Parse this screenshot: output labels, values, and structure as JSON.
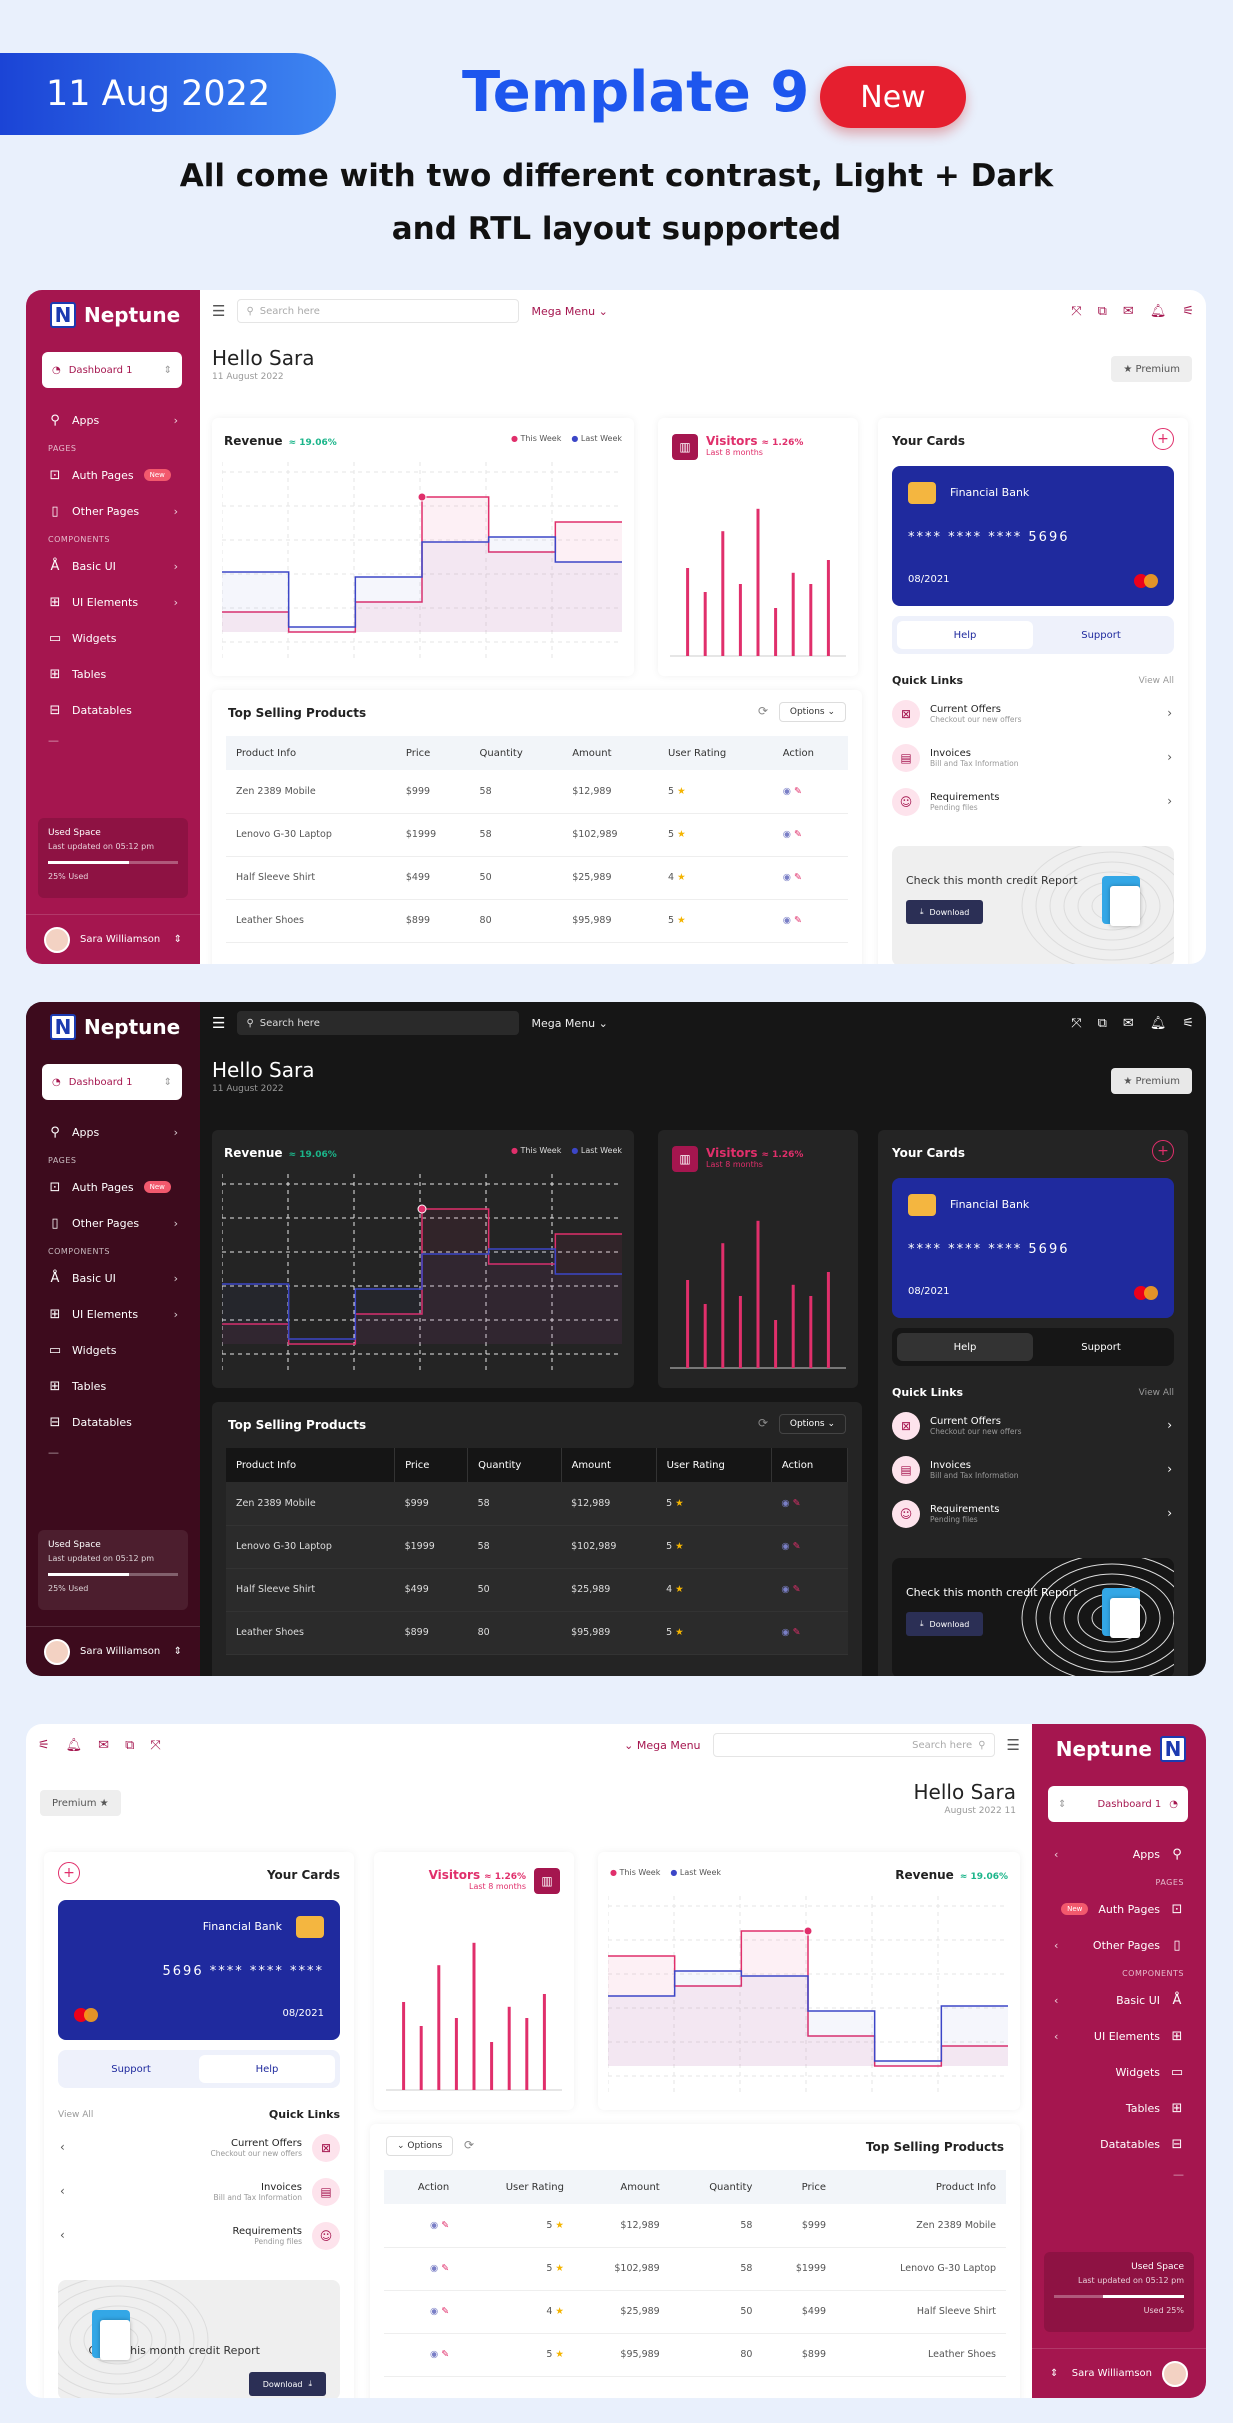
{
  "header": {
    "date": "11 Aug 2022",
    "title": "Template 9",
    "badge": "New",
    "subtitle_line1": "All come with two different contrast, Light + Dark",
    "subtitle_line2": "and RTL layout supported"
  },
  "app": {
    "brand": "Neptune",
    "logo_letter": "N",
    "dashboard_select": "Dashboard 1",
    "search_placeholder": "Search here",
    "mega_menu": "Mega Menu",
    "greeting": "Hello Sara",
    "date": "11 August 2022",
    "date_rtl": "August 2022 11",
    "premium": "★ Premium",
    "premium_rtl": "Premium ★",
    "nav": {
      "apps": "Apps",
      "pages_section": "PAGES",
      "auth_pages": "Auth Pages",
      "new_badge": "New",
      "other_pages": "Other Pages",
      "components_section": "COMPONENTS",
      "basic_ui": "Basic UI",
      "ui_elements": "UI Elements",
      "widgets": "Widgets",
      "tables": "Tables",
      "datatables": "Datatables",
      "dash": "—"
    },
    "space": {
      "title": "Used Space",
      "updated": "Last updated on 05:12 pm",
      "used": "25% Used",
      "used_rtl": "Used 25%",
      "percent": 0.25
    },
    "user": "Sara Williamson",
    "revenue": {
      "title": "Revenue",
      "pct": "≈ 19.06%",
      "legend_this": "This Week",
      "legend_last": "Last Week"
    },
    "visitors": {
      "title": "Visitors",
      "pct": "≈ 1.26%",
      "sub": "Last 8 months"
    },
    "cards": {
      "title": "Your Cards",
      "bank": "Financial Bank",
      "number": "**** **** **** 5696",
      "number_rtl": "5696 **** **** ****",
      "expiry": "08/2021",
      "tab_help": "Help",
      "tab_support": "Support"
    },
    "quick_links": {
      "title": "Quick Links",
      "view_all": "View All",
      "items": [
        {
          "title": "Current Offers",
          "sub": "Checkout our new offers"
        },
        {
          "title": "Invoices",
          "sub": "Bill and Tax Information"
        },
        {
          "title": "Requirements",
          "sub": "Pending files"
        }
      ]
    },
    "credit": {
      "title": "Check this month credit Report",
      "button": "Download"
    },
    "products": {
      "title": "Top Selling Products",
      "options": "Options",
      "headers": [
        "Product Info",
        "Price",
        "Quantity",
        "Amount",
        "User Rating",
        "Action"
      ],
      "rows": [
        {
          "name": "Zen 2389 Mobile",
          "price": "$999",
          "qty": "58",
          "amount": "$12,989",
          "rating": "5"
        },
        {
          "name": "Lenovo G-30 Laptop",
          "price": "$1999",
          "qty": "58",
          "amount": "$102,989",
          "rating": "5"
        },
        {
          "name": "Half Sleeve Shirt",
          "price": "$499",
          "qty": "50",
          "amount": "$25,989",
          "rating": "4"
        },
        {
          "name": "Leather Shoes",
          "price": "$899",
          "qty": "80",
          "amount": "$95,989",
          "rating": "5"
        }
      ]
    }
  },
  "chart_data": [
    {
      "type": "line",
      "title": "Revenue",
      "series": [
        {
          "name": "This Week",
          "values": [
            1,
            0.6,
            1.2,
            3.3,
            2.2,
            2.8
          ]
        },
        {
          "name": "Last Week",
          "values": [
            1.8,
            0.7,
            1.7,
            2.4,
            2.5,
            2.0
          ]
        }
      ],
      "colors": {
        "this": "#e02f6b",
        "last": "#3c46c7"
      }
    },
    {
      "type": "bar",
      "title": "Visitors",
      "values": [
        55,
        40,
        78,
        45,
        92,
        30,
        52,
        45,
        60
      ],
      "ylim": [
        0,
        100
      ],
      "color": "#e02f6b"
    }
  ]
}
